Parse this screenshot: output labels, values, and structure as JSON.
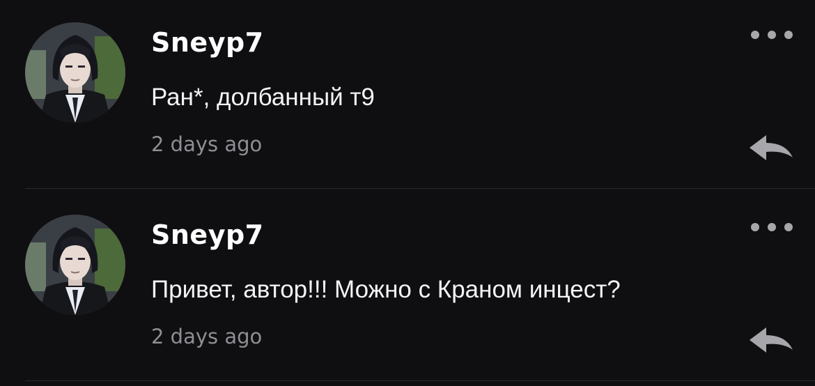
{
  "comments": [
    {
      "username": "Sneyp7",
      "text": "Ран*, долбанный т9",
      "time": "2 days ago",
      "avatar_icon": "anime-character-avatar",
      "more_icon": "more-options-icon",
      "reply_icon": "reply-arrow-icon"
    },
    {
      "username": "Sneyp7",
      "text": "Привет, автор!!! Можно с Краном инцест?",
      "time": "2 days ago",
      "avatar_icon": "anime-character-avatar",
      "more_icon": "more-options-icon",
      "reply_icon": "reply-arrow-icon"
    }
  ],
  "colors": {
    "background": "#0f0e11",
    "username": "#ffffff",
    "text": "#f4f4f4",
    "time": "#8e8e93",
    "icon": "#a6a6ab",
    "divider": "#2a2a2e"
  }
}
